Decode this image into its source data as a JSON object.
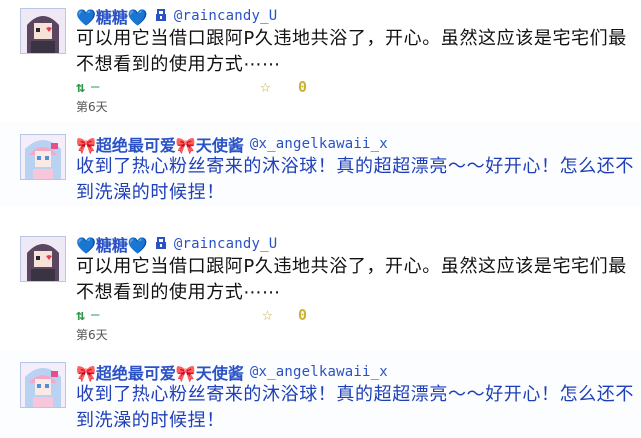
{
  "tweets": [
    {
      "name": "💙糖糖💙",
      "handle": "@raincandy_U",
      "text": "可以用它当借口跟阿P久违地共浴了，开心。虽然这应该是宅宅们最不想看到的使用方式⋯⋯",
      "rt_count": "—",
      "fav_count": "0",
      "time": "第6天"
    },
    {
      "name": "🎀超绝最可爱🎀天使酱",
      "handle": "@x_angelkawaii_x",
      "text": "收到了热心粉丝寄来的沐浴球！真的超超漂亮～～好开心！怎么还不到洗澡的时候捏！"
    },
    {
      "name": "💙糖糖💙",
      "handle": "@raincandy_U",
      "text": "可以用它当借口跟阿P久违地共浴了，开心。虽然这应该是宅宅们最不想看到的使用方式⋯⋯",
      "rt_count": "—",
      "fav_count": "0",
      "time": "第6天"
    },
    {
      "name": "🎀超绝最可爱🎀天使酱",
      "handle": "@x_angelkawaii_x",
      "text": "收到了热心粉丝寄来的沐浴球！真的超超漂亮～～好开心！怎么还不到洗澡的时候捏！"
    }
  ],
  "icons": {
    "lock": "lock-icon",
    "retweet": "retweet-icon",
    "favorite": "star-icon"
  },
  "colors": {
    "name": "#2a52c6",
    "retweet": "#2e9a48",
    "favorite": "#c8b23a",
    "angel_text": "#1f3fb7"
  }
}
